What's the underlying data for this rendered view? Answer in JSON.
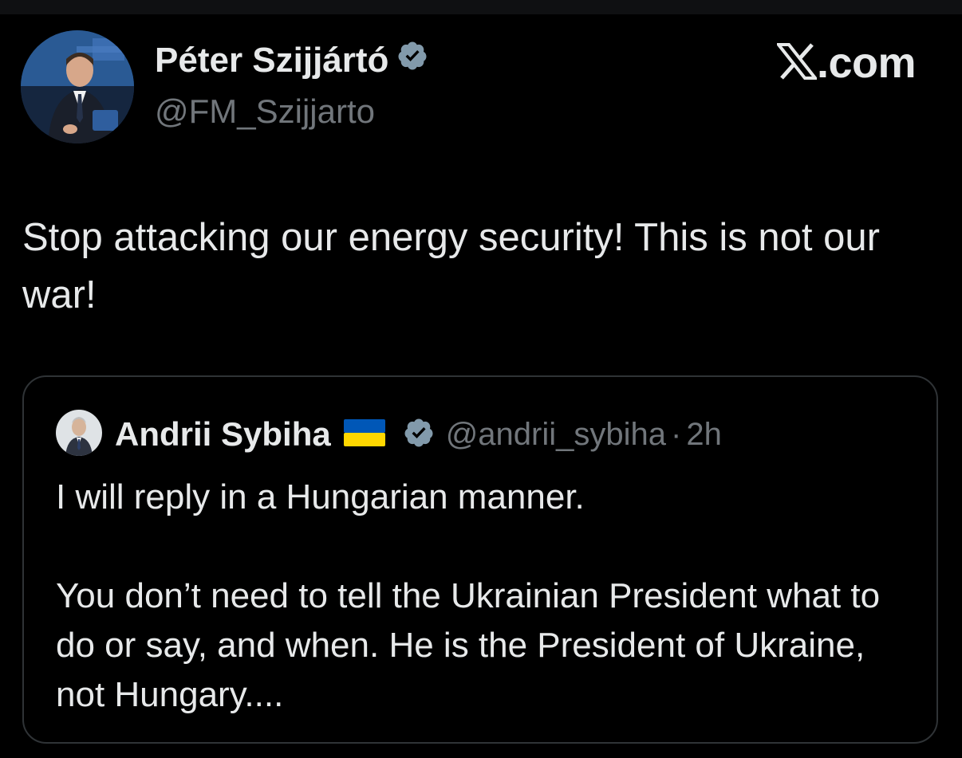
{
  "author": {
    "name": "Péter Szijjártó",
    "handle": "@FM_Szijjarto",
    "avatar": "profile-photo-man-in-suit",
    "verified_icon": "verified-badge-icon"
  },
  "brand": {
    "logo_icon": "x-logo-icon",
    "label": ".com"
  },
  "tweet": {
    "text": "Stop attacking our energy security! This is not our war!"
  },
  "quoted_tweet": {
    "author_name": "Andrii Sybiha",
    "flag_icon": "ukraine-flag-icon",
    "verified_icon": "verified-badge-icon",
    "handle": "@andrii_sybiha",
    "separator": "·",
    "time": "2h",
    "text": "I will reply in a Hungarian manner.\n\nYou don’t need to tell the Ukrainian President what to do or say, and when. He is the President of Ukraine, not Hungary...."
  },
  "colors": {
    "background": "#000000",
    "primary_text": "#e7e9ea",
    "secondary_text": "#71767b",
    "border": "#2f3336",
    "verified_badge": "#829aab",
    "flag_blue": "#0057b7",
    "flag_yellow": "#ffd700"
  }
}
